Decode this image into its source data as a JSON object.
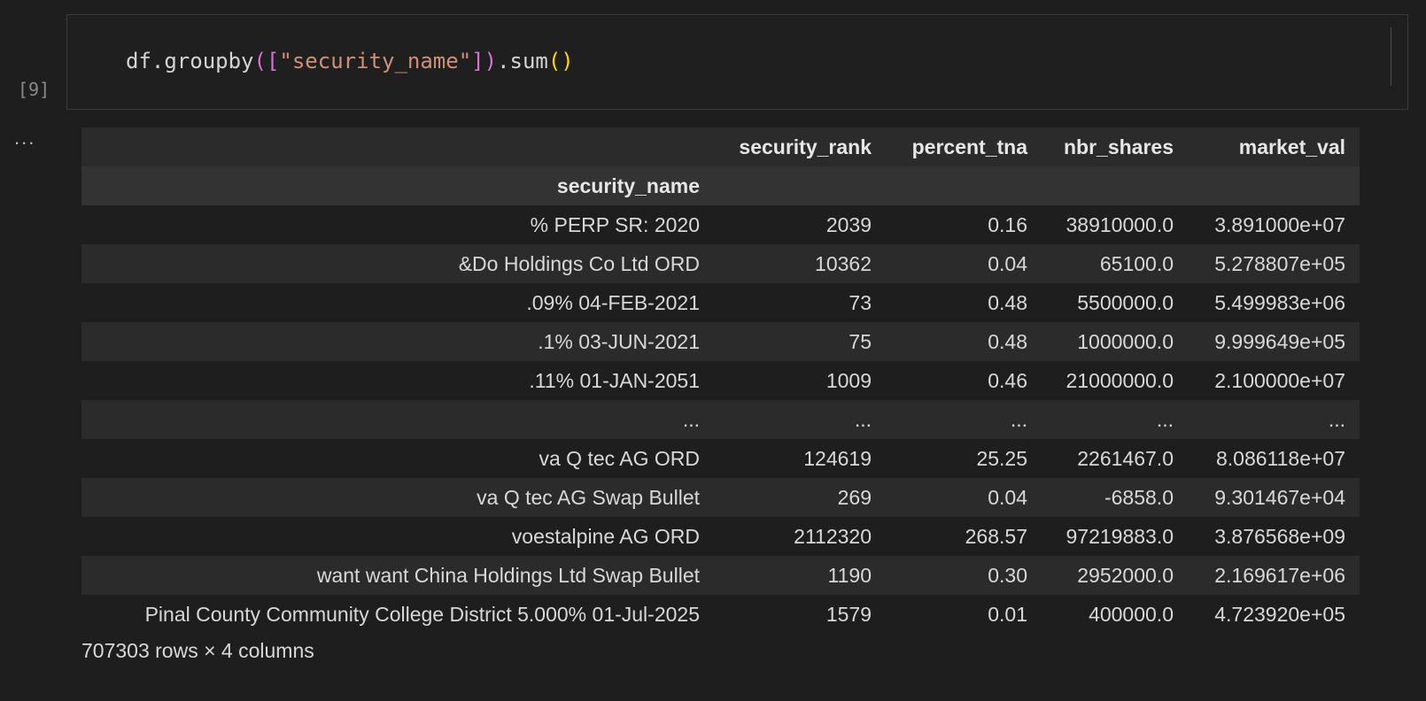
{
  "cell": {
    "execution_count": "[9]",
    "code": {
      "prefix": "df.groupby",
      "open_paren": "(",
      "open_bracket": "[",
      "string": "\"security_name\"",
      "close_bracket": "]",
      "close_paren": ")",
      "method": ".sum",
      "call_parens": "()"
    }
  },
  "output": {
    "ellipsis": "...",
    "table": {
      "columns": [
        "security_rank",
        "percent_tna",
        "nbr_shares",
        "market_val"
      ],
      "index_name": "security_name",
      "rows": [
        {
          "index": "% PERP SR: 2020",
          "values": [
            "2039",
            "0.16",
            "38910000.0",
            "3.891000e+07"
          ]
        },
        {
          "index": "&Do Holdings Co Ltd ORD",
          "values": [
            "10362",
            "0.04",
            "65100.0",
            "5.278807e+05"
          ]
        },
        {
          "index": ".09% 04-FEB-2021",
          "values": [
            "73",
            "0.48",
            "5500000.0",
            "5.499983e+06"
          ]
        },
        {
          "index": ".1% 03-JUN-2021",
          "values": [
            "75",
            "0.48",
            "1000000.0",
            "9.999649e+05"
          ]
        },
        {
          "index": ".11% 01-JAN-2051",
          "values": [
            "1009",
            "0.46",
            "21000000.0",
            "2.100000e+07"
          ]
        },
        {
          "index": "...",
          "values": [
            "...",
            "...",
            "...",
            "..."
          ]
        },
        {
          "index": "va Q tec AG ORD",
          "values": [
            "124619",
            "25.25",
            "2261467.0",
            "8.086118e+07"
          ]
        },
        {
          "index": "va Q tec AG Swap Bullet",
          "values": [
            "269",
            "0.04",
            "-6858.0",
            "9.301467e+04"
          ]
        },
        {
          "index": "voestalpine AG ORD",
          "values": [
            "2112320",
            "268.57",
            "97219883.0",
            "3.876568e+09"
          ]
        },
        {
          "index": "want want China Holdings Ltd Swap Bullet",
          "values": [
            "1190",
            "0.30",
            "2952000.0",
            "2.169617e+06"
          ]
        },
        {
          "index": "Pinal County Community College District 5.000% 01-Jul-2025",
          "values": [
            "1579",
            "0.01",
            "400000.0",
            "4.723920e+05"
          ]
        }
      ]
    },
    "shape": "707303 rows × 4 columns"
  }
}
